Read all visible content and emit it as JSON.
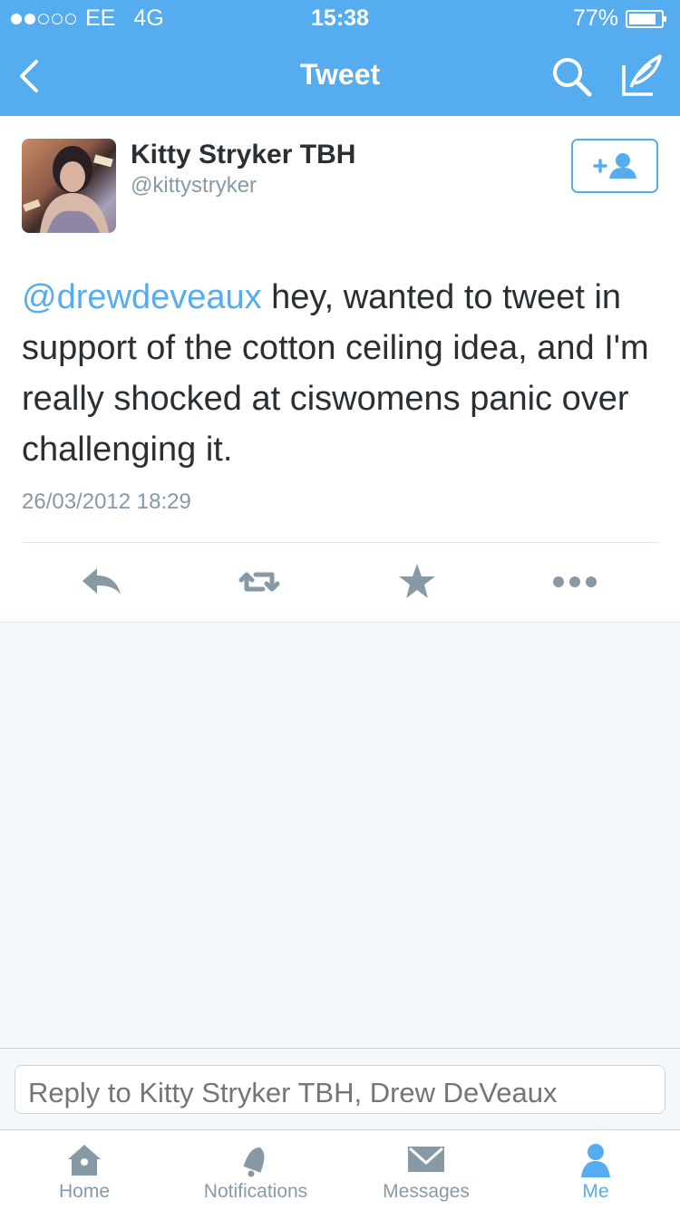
{
  "status_bar": {
    "carrier": "EE",
    "network": "4G",
    "time": "15:38",
    "battery": "77%",
    "battery_level": 0.77,
    "signal_bars": 2
  },
  "nav": {
    "title": "Tweet",
    "back_icon": "chevron-left-icon",
    "search_icon": "search-icon",
    "compose_icon": "compose-icon"
  },
  "tweet": {
    "author_name": "Kitty Stryker TBH",
    "author_handle": "@kittystryker",
    "mention": "@drewdeveaux",
    "text": " hey, wanted to tweet in support of the cotton ceiling idea, and I'm really shocked at ciswomens panic over challenging it.",
    "timestamp": "26/03/2012 18:29"
  },
  "actions": [
    "reply-icon",
    "retweet-icon",
    "favorite-icon",
    "more-icon"
  ],
  "reply": {
    "placeholder": "Reply to Kitty Stryker TBH, Drew DeVeaux"
  },
  "tabs": [
    {
      "label": "Home",
      "icon": "home-icon"
    },
    {
      "label": "Notifications",
      "icon": "bell-icon"
    },
    {
      "label": "Messages",
      "icon": "envelope-icon"
    },
    {
      "label": "Me",
      "icon": "person-icon",
      "active": true
    }
  ],
  "colors": {
    "accent": "#55acee",
    "text": "#292f33",
    "muted": "#8899a6",
    "background": "#f5f8fa"
  }
}
